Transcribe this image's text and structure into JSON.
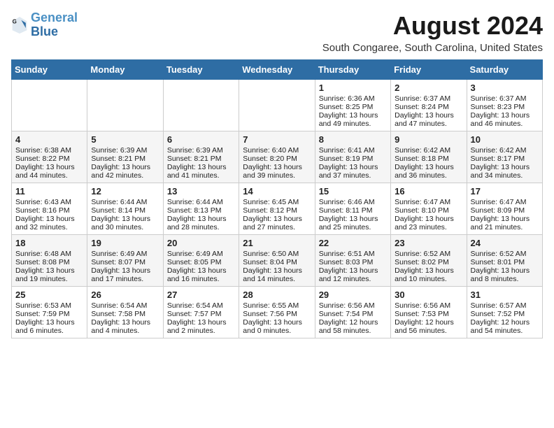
{
  "header": {
    "logo_line1": "General",
    "logo_line2": "Blue",
    "month_title": "August 2024",
    "subtitle": "South Congaree, South Carolina, United States"
  },
  "weekdays": [
    "Sunday",
    "Monday",
    "Tuesday",
    "Wednesday",
    "Thursday",
    "Friday",
    "Saturday"
  ],
  "weeks": [
    [
      {
        "day": "",
        "sunrise": "",
        "sunset": "",
        "daylight": ""
      },
      {
        "day": "",
        "sunrise": "",
        "sunset": "",
        "daylight": ""
      },
      {
        "day": "",
        "sunrise": "",
        "sunset": "",
        "daylight": ""
      },
      {
        "day": "",
        "sunrise": "",
        "sunset": "",
        "daylight": ""
      },
      {
        "day": "1",
        "sunrise": "Sunrise: 6:36 AM",
        "sunset": "Sunset: 8:25 PM",
        "daylight": "Daylight: 13 hours and 49 minutes."
      },
      {
        "day": "2",
        "sunrise": "Sunrise: 6:37 AM",
        "sunset": "Sunset: 8:24 PM",
        "daylight": "Daylight: 13 hours and 47 minutes."
      },
      {
        "day": "3",
        "sunrise": "Sunrise: 6:37 AM",
        "sunset": "Sunset: 8:23 PM",
        "daylight": "Daylight: 13 hours and 46 minutes."
      }
    ],
    [
      {
        "day": "4",
        "sunrise": "Sunrise: 6:38 AM",
        "sunset": "Sunset: 8:22 PM",
        "daylight": "Daylight: 13 hours and 44 minutes."
      },
      {
        "day": "5",
        "sunrise": "Sunrise: 6:39 AM",
        "sunset": "Sunset: 8:21 PM",
        "daylight": "Daylight: 13 hours and 42 minutes."
      },
      {
        "day": "6",
        "sunrise": "Sunrise: 6:39 AM",
        "sunset": "Sunset: 8:21 PM",
        "daylight": "Daylight: 13 hours and 41 minutes."
      },
      {
        "day": "7",
        "sunrise": "Sunrise: 6:40 AM",
        "sunset": "Sunset: 8:20 PM",
        "daylight": "Daylight: 13 hours and 39 minutes."
      },
      {
        "day": "8",
        "sunrise": "Sunrise: 6:41 AM",
        "sunset": "Sunset: 8:19 PM",
        "daylight": "Daylight: 13 hours and 37 minutes."
      },
      {
        "day": "9",
        "sunrise": "Sunrise: 6:42 AM",
        "sunset": "Sunset: 8:18 PM",
        "daylight": "Daylight: 13 hours and 36 minutes."
      },
      {
        "day": "10",
        "sunrise": "Sunrise: 6:42 AM",
        "sunset": "Sunset: 8:17 PM",
        "daylight": "Daylight: 13 hours and 34 minutes."
      }
    ],
    [
      {
        "day": "11",
        "sunrise": "Sunrise: 6:43 AM",
        "sunset": "Sunset: 8:16 PM",
        "daylight": "Daylight: 13 hours and 32 minutes."
      },
      {
        "day": "12",
        "sunrise": "Sunrise: 6:44 AM",
        "sunset": "Sunset: 8:14 PM",
        "daylight": "Daylight: 13 hours and 30 minutes."
      },
      {
        "day": "13",
        "sunrise": "Sunrise: 6:44 AM",
        "sunset": "Sunset: 8:13 PM",
        "daylight": "Daylight: 13 hours and 28 minutes."
      },
      {
        "day": "14",
        "sunrise": "Sunrise: 6:45 AM",
        "sunset": "Sunset: 8:12 PM",
        "daylight": "Daylight: 13 hours and 27 minutes."
      },
      {
        "day": "15",
        "sunrise": "Sunrise: 6:46 AM",
        "sunset": "Sunset: 8:11 PM",
        "daylight": "Daylight: 13 hours and 25 minutes."
      },
      {
        "day": "16",
        "sunrise": "Sunrise: 6:47 AM",
        "sunset": "Sunset: 8:10 PM",
        "daylight": "Daylight: 13 hours and 23 minutes."
      },
      {
        "day": "17",
        "sunrise": "Sunrise: 6:47 AM",
        "sunset": "Sunset: 8:09 PM",
        "daylight": "Daylight: 13 hours and 21 minutes."
      }
    ],
    [
      {
        "day": "18",
        "sunrise": "Sunrise: 6:48 AM",
        "sunset": "Sunset: 8:08 PM",
        "daylight": "Daylight: 13 hours and 19 minutes."
      },
      {
        "day": "19",
        "sunrise": "Sunrise: 6:49 AM",
        "sunset": "Sunset: 8:07 PM",
        "daylight": "Daylight: 13 hours and 17 minutes."
      },
      {
        "day": "20",
        "sunrise": "Sunrise: 6:49 AM",
        "sunset": "Sunset: 8:05 PM",
        "daylight": "Daylight: 13 hours and 16 minutes."
      },
      {
        "day": "21",
        "sunrise": "Sunrise: 6:50 AM",
        "sunset": "Sunset: 8:04 PM",
        "daylight": "Daylight: 13 hours and 14 minutes."
      },
      {
        "day": "22",
        "sunrise": "Sunrise: 6:51 AM",
        "sunset": "Sunset: 8:03 PM",
        "daylight": "Daylight: 13 hours and 12 minutes."
      },
      {
        "day": "23",
        "sunrise": "Sunrise: 6:52 AM",
        "sunset": "Sunset: 8:02 PM",
        "daylight": "Daylight: 13 hours and 10 minutes."
      },
      {
        "day": "24",
        "sunrise": "Sunrise: 6:52 AM",
        "sunset": "Sunset: 8:01 PM",
        "daylight": "Daylight: 13 hours and 8 minutes."
      }
    ],
    [
      {
        "day": "25",
        "sunrise": "Sunrise: 6:53 AM",
        "sunset": "Sunset: 7:59 PM",
        "daylight": "Daylight: 13 hours and 6 minutes."
      },
      {
        "day": "26",
        "sunrise": "Sunrise: 6:54 AM",
        "sunset": "Sunset: 7:58 PM",
        "daylight": "Daylight: 13 hours and 4 minutes."
      },
      {
        "day": "27",
        "sunrise": "Sunrise: 6:54 AM",
        "sunset": "Sunset: 7:57 PM",
        "daylight": "Daylight: 13 hours and 2 minutes."
      },
      {
        "day": "28",
        "sunrise": "Sunrise: 6:55 AM",
        "sunset": "Sunset: 7:56 PM",
        "daylight": "Daylight: 13 hours and 0 minutes."
      },
      {
        "day": "29",
        "sunrise": "Sunrise: 6:56 AM",
        "sunset": "Sunset: 7:54 PM",
        "daylight": "Daylight: 12 hours and 58 minutes."
      },
      {
        "day": "30",
        "sunrise": "Sunrise: 6:56 AM",
        "sunset": "Sunset: 7:53 PM",
        "daylight": "Daylight: 12 hours and 56 minutes."
      },
      {
        "day": "31",
        "sunrise": "Sunrise: 6:57 AM",
        "sunset": "Sunset: 7:52 PM",
        "daylight": "Daylight: 12 hours and 54 minutes."
      }
    ]
  ]
}
